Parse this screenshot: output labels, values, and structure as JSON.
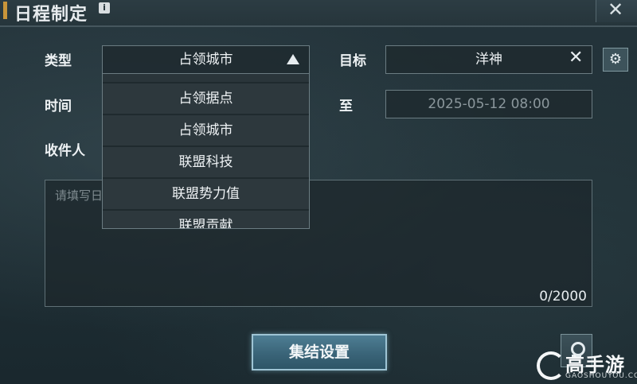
{
  "window": {
    "title": "日程制定",
    "info_icon": "i"
  },
  "form": {
    "type_label": "类型",
    "type_value": "占领城市",
    "target_label": "目标",
    "target_value": "洋神",
    "time_label": "时间",
    "to_label": "至",
    "end_time": "2025-05-12 08:00",
    "recipient_label": "收件人",
    "message_placeholder": "请填写日",
    "counter": "0/2000"
  },
  "dropdown": {
    "items": [
      "占领据点",
      "占领城市",
      "联盟科技",
      "联盟势力值",
      "联盟贡献"
    ]
  },
  "buttons": {
    "rally_label": "集结设置"
  },
  "watermark": {
    "brand": "高手游",
    "sub": "GAOSHOUYOU.COM"
  },
  "icons": [
    "info-icon",
    "close-icon",
    "triangle-up-icon",
    "clear-icon",
    "gear-icon",
    "location-pin-icon"
  ]
}
